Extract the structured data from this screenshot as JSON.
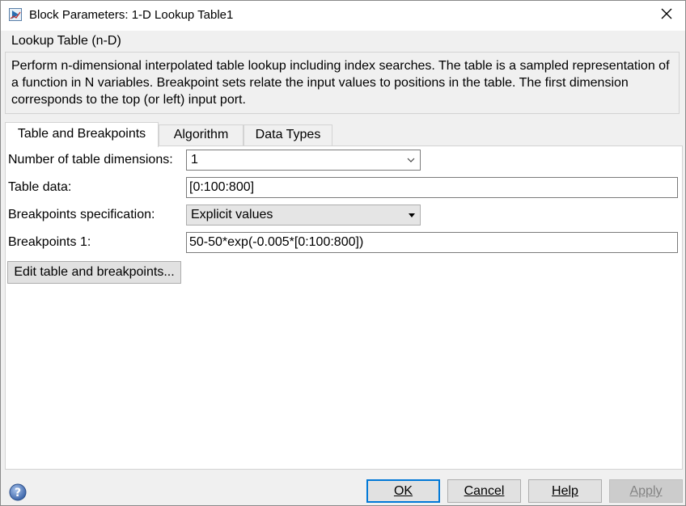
{
  "window": {
    "title": "Block Parameters: 1-D Lookup Table1",
    "app_icon": "simulink-block-icon",
    "close_icon": "close-icon"
  },
  "group": {
    "title": "Lookup Table (n-D)",
    "description": "Perform n-dimensional interpolated table lookup including index searches. The table is a sampled representation of a function in N variables. Breakpoint sets relate the input values to positions in the table. The first dimension corresponds to the top (or left) input port."
  },
  "tabs": [
    {
      "label": "Table and Breakpoints",
      "active": true
    },
    {
      "label": "Algorithm",
      "active": false
    },
    {
      "label": "Data Types",
      "active": false
    }
  ],
  "form": {
    "dimensions": {
      "label": "Number of table dimensions:",
      "value": "1"
    },
    "table_data": {
      "label": "Table data:",
      "value": "[0:100:800]"
    },
    "bp_spec": {
      "label": "Breakpoints specification:",
      "value": "Explicit values"
    },
    "bp1": {
      "label": "Breakpoints 1:",
      "value": "50-50*exp(-0.005*[0:100:800])"
    },
    "edit_button": "Edit table and breakpoints..."
  },
  "buttons": {
    "ok": "OK",
    "cancel": "Cancel",
    "help": "Help",
    "apply": "Apply",
    "help_icon": "help-question-icon"
  },
  "colors": {
    "accent": "#0078d7",
    "background": "#f0f0f0"
  }
}
